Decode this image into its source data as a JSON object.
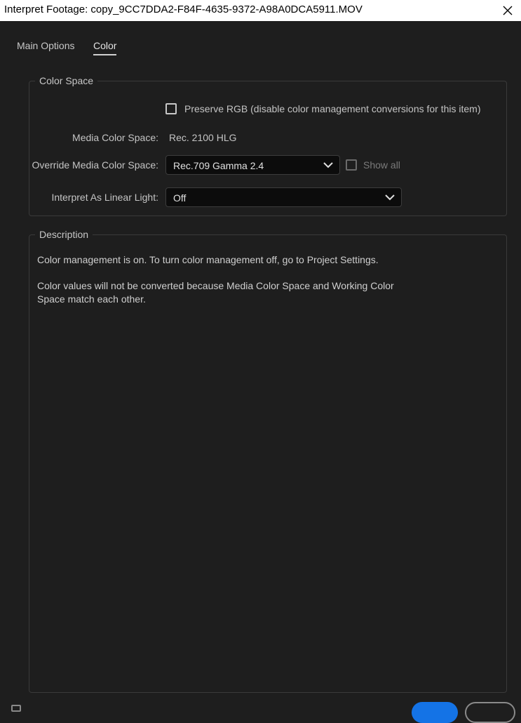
{
  "window": {
    "title": "Interpret Footage: copy_9CC7DDA2-F84F-4635-9372-A98A0DCA5911.MOV",
    "close_icon": "close-icon"
  },
  "tabs": [
    {
      "label": "Main Options",
      "active": false
    },
    {
      "label": "Color",
      "active": true
    }
  ],
  "color_space": {
    "legend": "Color Space",
    "preserve_rgb": {
      "label": "Preserve RGB (disable color management conversions for this item)",
      "checked": false
    },
    "media_color_space": {
      "label": "Media Color Space:",
      "value": "Rec. 2100 HLG"
    },
    "override_media_color_space": {
      "label": "Override Media Color Space:",
      "selected": "Rec.709 Gamma 2.4",
      "show_all": {
        "label": "Show all",
        "checked": false,
        "enabled": false
      }
    },
    "interpret_linear_light": {
      "label": "Interpret As Linear Light:",
      "selected": "Off"
    }
  },
  "description": {
    "legend": "Description",
    "line1": "Color management is on. To turn color management off, go to Project Settings.",
    "line2": "Color values will not be converted because Media Color Space and Working Color Space match each other."
  },
  "colors": {
    "background": "#1e1e1e",
    "primary_button": "#1473e6"
  }
}
